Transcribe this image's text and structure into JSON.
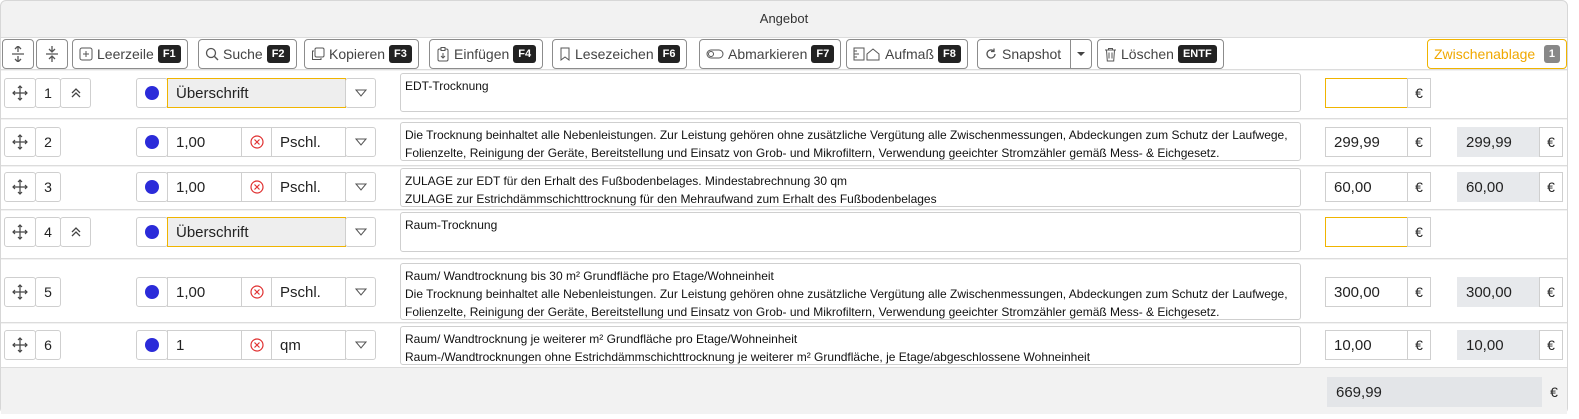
{
  "window": {
    "title": "Angebot"
  },
  "toolbar": {
    "leerzeile": {
      "label": "Leerzeile",
      "key": "F1"
    },
    "suche": {
      "label": "Suche",
      "key": "F2"
    },
    "kopieren": {
      "label": "Kopieren",
      "key": "F3"
    },
    "einfuegen": {
      "label": "Einfügen",
      "key": "F4"
    },
    "lesezeichen": {
      "label": "Lesezeichen",
      "key": "F6"
    },
    "abmarkieren": {
      "label": "Abmarkieren",
      "key": "F7"
    },
    "aufmass": {
      "label": "Aufmaß",
      "key": "F8"
    },
    "snapshot": {
      "label": "Snapshot"
    },
    "loeschen": {
      "label": "Löschen",
      "key": "ENTF"
    },
    "zwischenablage": {
      "label": "Zwischenablage",
      "count": "1"
    }
  },
  "rows": [
    {
      "number": "1",
      "type": "Überschrift",
      "lines": [
        "EDT-Trocknung"
      ],
      "price": "",
      "total": ""
    },
    {
      "number": "2",
      "quantity": "1,00",
      "unit": "Pschl.",
      "lines": [
        "Die Trocknung beinhaltet alle Nebenleistungen. Zur Leistung gehören ohne zusätzliche Vergütung alle Zwischenmessungen, Abdeckungen zum Schutz der Laufwege,",
        "Folienzelte, Reinigung der Geräte, Bereitstellung und Einsatz von Grob- und Mikrofiltern, Verwendung geeichter Stromzähler gemäß Mess- & Eichgesetz."
      ],
      "price": "299,99",
      "total": "299,99"
    },
    {
      "number": "3",
      "quantity": "1,00",
      "unit": "Pschl.",
      "lines": [
        "ZULAGE zur EDT für den Erhalt des Fußbodenbelages. Mindestabrechnung 30 qm",
        "ZULAGE zur Estrichdämmschichttrocknung für den Mehraufwand zum Erhalt des Fußbodenbelages"
      ],
      "price": "60,00",
      "total": "60,00"
    },
    {
      "number": "4",
      "type": "Überschrift",
      "lines": [
        "Raum-Trocknung"
      ],
      "price": "",
      "total": ""
    },
    {
      "number": "5",
      "quantity": "1,00",
      "unit": "Pschl.",
      "lines": [
        "Raum/ Wandtrocknung bis 30 m² Grundfläche pro Etage/Wohneinheit",
        "Die Trocknung beinhaltet alle Nebenleistungen. Zur Leistung gehören ohne zusätzliche Vergütung alle Zwischenmessungen, Abdeckungen zum Schutz der Laufwege,",
        "Folienzelte, Reinigung der Geräte, Bereitstellung und Einsatz von Grob- und Mikrofiltern, Verwendung geeichter Stromzähler gemäß Mess- & Eichgesetz."
      ],
      "price": "300,00",
      "total": "300,00"
    },
    {
      "number": "6",
      "quantity": "1",
      "unit": "qm",
      "lines": [
        "Raum/ Wandtrocknung je weiterer m² Grundfläche pro Etage/Wohneinheit",
        "Raum-/Wandtrocknungen ohne Estrichdämmschichttrocknung je weiterer m² Grundfläche, je Etage/abgeschlossene Wohneinheit"
      ],
      "price": "10,00",
      "total": "10,00"
    }
  ],
  "currency": "€",
  "sum": "669,99",
  "colors": {
    "accent": "#f0b400",
    "dot": "#2b2bd9",
    "error": "#e03131"
  }
}
